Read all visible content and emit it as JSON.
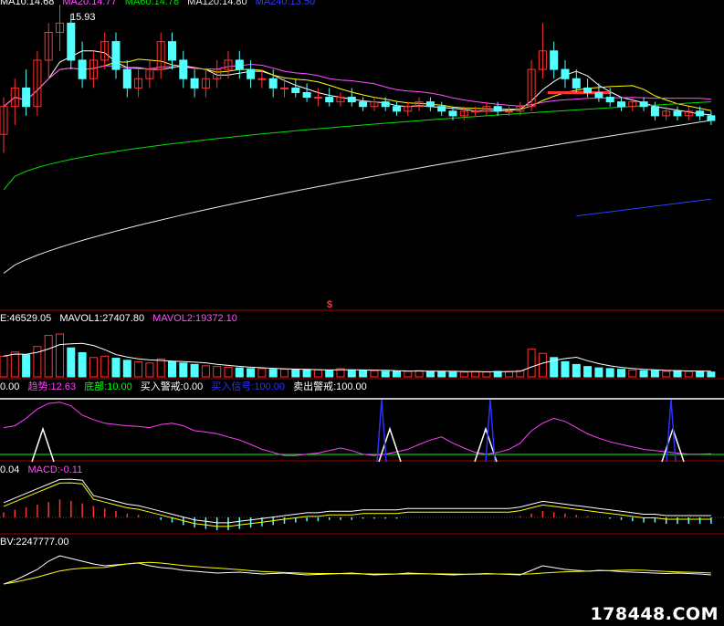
{
  "colors": {
    "up": "#ff3232",
    "down": "#54ffff",
    "ma5": "#ffffff",
    "ma10": "#ffff00",
    "ma20": "#ff50ff",
    "ma60": "#00e000",
    "ma120": "#e8e8e8",
    "ma250": "#2d3dff",
    "separator": "#a00000",
    "trend": "#ff40ff",
    "bottom": "#00ff00",
    "buy_warn": "#ffffff",
    "buy_signal": "#3030ff",
    "sell_warn": "#ffffff"
  },
  "main": {
    "legend": [
      {
        "text": "MA10:14.68",
        "color": "#ffffff"
      },
      {
        "text": "MA20:14.77",
        "color": "#ff50ff"
      },
      {
        "text": "MA60:14.78",
        "color": "#00e000"
      },
      {
        "text": "MA120:14.80",
        "color": "#e8e8e8"
      },
      {
        "text": "MA240:13.50",
        "color": "#2d3dff"
      }
    ],
    "high_label": "15.93",
    "marker": "$"
  },
  "volume": {
    "legend": [
      {
        "text": "E:46529.05",
        "color": "#ffffff"
      },
      {
        "text": "MAVOL1:27407.80",
        "color": "#ffffff"
      },
      {
        "text": "MAVOL2:19372.10",
        "color": "#ff50ff"
      }
    ]
  },
  "indicator": {
    "legend": [
      {
        "text": "0.00",
        "color": "#ffffff"
      },
      {
        "text": "趋势:12.63",
        "color": "#ff40ff"
      },
      {
        "text": "底部:10.00",
        "color": "#00ff00"
      },
      {
        "text": "买入警戒:0.00",
        "color": "#ffffff"
      },
      {
        "text": "买入信号:100.00",
        "color": "#3030ff"
      },
      {
        "text": "卖出警戒:100.00",
        "color": "#ffffff"
      }
    ]
  },
  "macd": {
    "legend": [
      {
        "text": "0.04",
        "color": "#ffffff"
      },
      {
        "text": "MACD:-0.11",
        "color": "#ff50ff"
      }
    ]
  },
  "obv": {
    "legend": [
      {
        "text": "BV:2247777.00",
        "color": "#ffffff"
      }
    ]
  },
  "watermark": "178448.COM",
  "chart_data": [
    {
      "type": "candlestick",
      "title": "",
      "series_lines": [
        "MA10",
        "MA20",
        "MA60",
        "MA120",
        "MA240"
      ],
      "annotations": [
        "15.93"
      ],
      "ylim": [
        12.9,
        16.1
      ],
      "candles": [
        [
          14.7,
          15.1,
          14.5,
          15.0
        ],
        [
          15.0,
          15.3,
          14.8,
          15.2
        ],
        [
          15.2,
          15.4,
          14.9,
          15.0
        ],
        [
          15.0,
          15.6,
          14.9,
          15.5
        ],
        [
          15.5,
          15.9,
          15.3,
          15.8
        ],
        [
          15.8,
          16.1,
          15.6,
          15.9
        ],
        [
          15.9,
          16.0,
          15.4,
          15.5
        ],
        [
          15.5,
          15.7,
          15.2,
          15.3
        ],
        [
          15.3,
          15.6,
          15.2,
          15.5
        ],
        [
          15.5,
          15.8,
          15.4,
          15.7
        ],
        [
          15.7,
          15.8,
          15.3,
          15.4
        ],
        [
          15.4,
          15.5,
          15.1,
          15.2
        ],
        [
          15.2,
          15.4,
          15.1,
          15.3
        ],
        [
          15.3,
          15.5,
          15.2,
          15.4
        ],
        [
          15.4,
          15.8,
          15.3,
          15.7
        ],
        [
          15.7,
          15.8,
          15.4,
          15.5
        ],
        [
          15.5,
          15.6,
          15.2,
          15.3
        ],
        [
          15.3,
          15.4,
          15.1,
          15.2
        ],
        [
          15.2,
          15.4,
          15.1,
          15.3
        ],
        [
          15.3,
          15.5,
          15.2,
          15.4
        ],
        [
          15.4,
          15.6,
          15.3,
          15.5
        ],
        [
          15.5,
          15.6,
          15.3,
          15.4
        ],
        [
          15.4,
          15.5,
          15.2,
          15.3
        ],
        [
          15.3,
          15.4,
          15.2,
          15.3
        ],
        [
          15.3,
          15.4,
          15.1,
          15.2
        ],
        [
          15.2,
          15.3,
          15.1,
          15.2
        ],
        [
          15.2,
          15.3,
          15.1,
          15.15
        ],
        [
          15.15,
          15.25,
          15.05,
          15.1
        ],
        [
          15.1,
          15.2,
          15.0,
          15.1
        ],
        [
          15.1,
          15.2,
          15.0,
          15.05
        ],
        [
          15.05,
          15.15,
          15.0,
          15.1
        ],
        [
          15.1,
          15.2,
          15.0,
          15.05
        ],
        [
          15.05,
          15.1,
          14.95,
          15.0
        ],
        [
          15.0,
          15.1,
          14.95,
          15.05
        ],
        [
          15.05,
          15.1,
          14.95,
          15.0
        ],
        [
          15.0,
          15.05,
          14.9,
          14.95
        ],
        [
          14.95,
          15.05,
          14.9,
          15.0
        ],
        [
          15.0,
          15.1,
          14.95,
          15.05
        ],
        [
          15.05,
          15.1,
          14.95,
          15.0
        ],
        [
          15.0,
          15.05,
          14.9,
          14.95
        ],
        [
          14.95,
          15.0,
          14.85,
          14.9
        ],
        [
          14.9,
          15.0,
          14.85,
          14.95
        ],
        [
          14.95,
          15.0,
          14.9,
          14.95
        ],
        [
          14.95,
          15.05,
          14.9,
          15.0
        ],
        [
          15.0,
          15.05,
          14.9,
          14.95
        ],
        [
          14.95,
          15.0,
          14.9,
          14.95
        ],
        [
          14.95,
          15.05,
          14.9,
          15.0
        ],
        [
          15.0,
          15.5,
          14.95,
          15.4
        ],
        [
          15.4,
          15.9,
          15.3,
          15.6
        ],
        [
          15.6,
          15.7,
          15.3,
          15.4
        ],
        [
          15.4,
          15.5,
          15.2,
          15.3
        ],
        [
          15.3,
          15.4,
          15.15,
          15.2
        ],
        [
          15.2,
          15.3,
          15.1,
          15.15
        ],
        [
          15.15,
          15.25,
          15.05,
          15.1
        ],
        [
          15.1,
          15.2,
          15.0,
          15.05
        ],
        [
          15.05,
          15.1,
          14.95,
          15.0
        ],
        [
          15.0,
          15.1,
          14.95,
          15.05
        ],
        [
          15.05,
          15.1,
          14.95,
          15.0
        ],
        [
          15.0,
          15.05,
          14.85,
          14.9
        ],
        [
          14.9,
          15.0,
          14.85,
          14.95
        ],
        [
          14.95,
          15.0,
          14.85,
          14.9
        ],
        [
          14.9,
          15.0,
          14.85,
          14.95
        ],
        [
          14.95,
          15.0,
          14.85,
          14.9
        ],
        [
          14.9,
          14.95,
          14.8,
          14.85
        ]
      ]
    },
    {
      "type": "bar",
      "title": "",
      "series": [
        {
          "name": "MAVOL1",
          "values": []
        },
        {
          "name": "MAVOL2",
          "values": []
        }
      ],
      "values": [
        30,
        36,
        32,
        44,
        60,
        62,
        42,
        35,
        28,
        30,
        27,
        24,
        22,
        20,
        26,
        22,
        20,
        18,
        16,
        15,
        14,
        13,
        12,
        12,
        11,
        11,
        10,
        10,
        10,
        9,
        12,
        10,
        9,
        9,
        8,
        8,
        8,
        9,
        8,
        8,
        7,
        7,
        8,
        7,
        8,
        8,
        9,
        40,
        34,
        28,
        22,
        18,
        15,
        13,
        12,
        11,
        10,
        9,
        9,
        8,
        9,
        8,
        8,
        7
      ],
      "ylim": [
        0,
        70
      ]
    },
    {
      "type": "line",
      "title": "",
      "series": [
        {
          "name": "趋势",
          "values": [
            55,
            58,
            70,
            85,
            94,
            96,
            90,
            75,
            68,
            62,
            60,
            58,
            57,
            55,
            60,
            62,
            58,
            50,
            48,
            45,
            40,
            35,
            28,
            20,
            15,
            10,
            10,
            12,
            14,
            18,
            22,
            18,
            12,
            10,
            12,
            16,
            20,
            28,
            35,
            40,
            30,
            22,
            15,
            12,
            15,
            20,
            30,
            50,
            62,
            70,
            65,
            55,
            45,
            38,
            32,
            28,
            24,
            20,
            18,
            16,
            14,
            12,
            12,
            13
          ]
        },
        {
          "name": "买入信号",
          "values": [
            0,
            0,
            0,
            0,
            0,
            0,
            0,
            0,
            0,
            0,
            0,
            0,
            0,
            0,
            0,
            0,
            0,
            0,
            0,
            0,
            0,
            0,
            0,
            0,
            0,
            0,
            0,
            0,
            0,
            0,
            0,
            0,
            0,
            0,
            0,
            0,
            0,
            0,
            0,
            0,
            0,
            0,
            0,
            0,
            0,
            0,
            0,
            0,
            0,
            0,
            0,
            0,
            0,
            0,
            0,
            0,
            0,
            0,
            0,
            0,
            100,
            0,
            0,
            0
          ]
        }
      ],
      "ylim": [
        0,
        100
      ]
    },
    {
      "type": "bar",
      "title": "",
      "series": [
        {
          "name": "MACD",
          "values": [
            0.04,
            0.06,
            0.08,
            0.1,
            0.12,
            0.14,
            0.13,
            0.11,
            0.09,
            0.07,
            0.05,
            0.03,
            0.02,
            0.0,
            -0.02,
            -0.04,
            -0.06,
            -0.08,
            -0.09,
            -0.1,
            -0.1,
            -0.09,
            -0.08,
            -0.07,
            -0.06,
            -0.05,
            -0.04,
            -0.03,
            -0.03,
            -0.02,
            -0.02,
            -0.02,
            -0.01,
            -0.01,
            -0.01,
            -0.01,
            0.0,
            0.0,
            0.0,
            0.0,
            0.0,
            0.0,
            0.0,
            0.0,
            0.0,
            0.0,
            0.01,
            0.03,
            0.05,
            0.04,
            0.03,
            0.02,
            0.01,
            0.0,
            -0.01,
            -0.02,
            -0.03,
            -0.04,
            -0.04,
            -0.05,
            -0.05,
            -0.05,
            -0.05,
            -0.05
          ]
        }
      ],
      "ylim": [
        -0.15,
        0.15
      ]
    },
    {
      "type": "line",
      "title": "",
      "series": [
        {
          "name": "OBV",
          "values": [
            20,
            28,
            40,
            52,
            70,
            82,
            76,
            70,
            64,
            60,
            62,
            64,
            66,
            60,
            56,
            54,
            50,
            48,
            46,
            44,
            45,
            46,
            44,
            42,
            43,
            44,
            42,
            40,
            41,
            42,
            43,
            44,
            42,
            40,
            41,
            42,
            44,
            43,
            42,
            41,
            40,
            41,
            42,
            43,
            42,
            41,
            40,
            50,
            60,
            56,
            52,
            50,
            48,
            50,
            49,
            47,
            46,
            45,
            44,
            43,
            44,
            43,
            42,
            40
          ]
        }
      ],
      "ylim": [
        0,
        100
      ]
    }
  ]
}
